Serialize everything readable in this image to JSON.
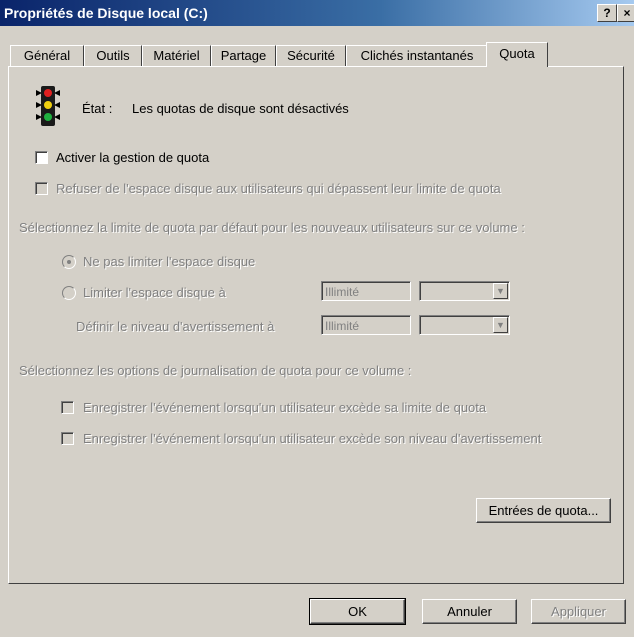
{
  "window": {
    "title": "Propriétés de Disque local (C:)",
    "help_button": "?",
    "close_button": "×"
  },
  "tabs": [
    "Général",
    "Outils",
    "Matériel",
    "Partage",
    "Sécurité",
    "Clichés instantanés",
    "Quota"
  ],
  "active_tab": "Quota",
  "status": {
    "label": "État :",
    "value": "Les quotas de disque sont désactivés",
    "icon": "traffic-light-icon"
  },
  "options": {
    "enable_quota": "Activer la gestion de quota",
    "deny_space": "Refuser de l'espace disque aux utilisateurs qui dépassent leur limite de quota"
  },
  "defaults": {
    "heading": "Sélectionnez la limite de quota par défaut pour les nouveaux utilisateurs sur ce volume :",
    "no_limit": "Ne pas limiter l'espace disque",
    "limit_to": "Limiter l'espace disque à",
    "warning_level": "Définir le niveau d'avertissement à",
    "limit_value": "Illimité",
    "warning_value": "Illimité"
  },
  "logging": {
    "heading": "Sélectionnez les options de journalisation de quota pour ce volume :",
    "log_limit": "Enregistrer l'événement lorsqu'un utilisateur excède sa limite de quota",
    "log_warning": "Enregistrer l'événement lorsqu'un utilisateur excède son niveau d'avertissement"
  },
  "buttons": {
    "quota_entries": "Entrées de quota...",
    "ok": "OK",
    "cancel": "Annuler",
    "apply": "Appliquer"
  }
}
